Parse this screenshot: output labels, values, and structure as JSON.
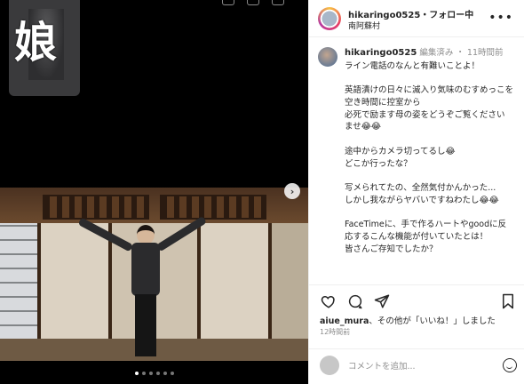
{
  "pip": {
    "label": "娘"
  },
  "post": {
    "username": "hikaringo0525",
    "follow_text": "・フォロー中",
    "location": "南阿蘇村"
  },
  "caption": {
    "username": "hikaringo0525",
    "edited": "編集済み",
    "time": "11時間前",
    "text": "ライン電話のなんと有難いことよ！\n\n英語漬けの日々に滅入り気味のむすめっこを\n空き時間に控室から\n必死で励ます母の姿をどうぞご覧くださいませ😂😂\n\n途中からカメラ切ってるし😂\nどこか行ったな？\n\n写メられてたの、全然気付かんかった...\nしかし我ながらヤバいですねわたし😂😂\n\nFaceTimeに、手で作るハートやgoodに反応するこんな機能が付いていたとは！\n皆さんご存知でしたか？"
  },
  "likes": {
    "user": "aiue_mura",
    "rest": "、その他が「いいね！」しました"
  },
  "post_time": "12時間前",
  "comment": {
    "placeholder": "コメントを追加..."
  },
  "carousel": {
    "count": 6,
    "active": 0
  },
  "colors": {
    "accent": "#262626",
    "muted": "#8e8e8e",
    "border": "#efefef"
  },
  "icons": [
    "heart-icon",
    "comment-icon",
    "share-icon",
    "bookmark-icon",
    "more-icon",
    "chevron-right-icon",
    "emoji-icon"
  ]
}
